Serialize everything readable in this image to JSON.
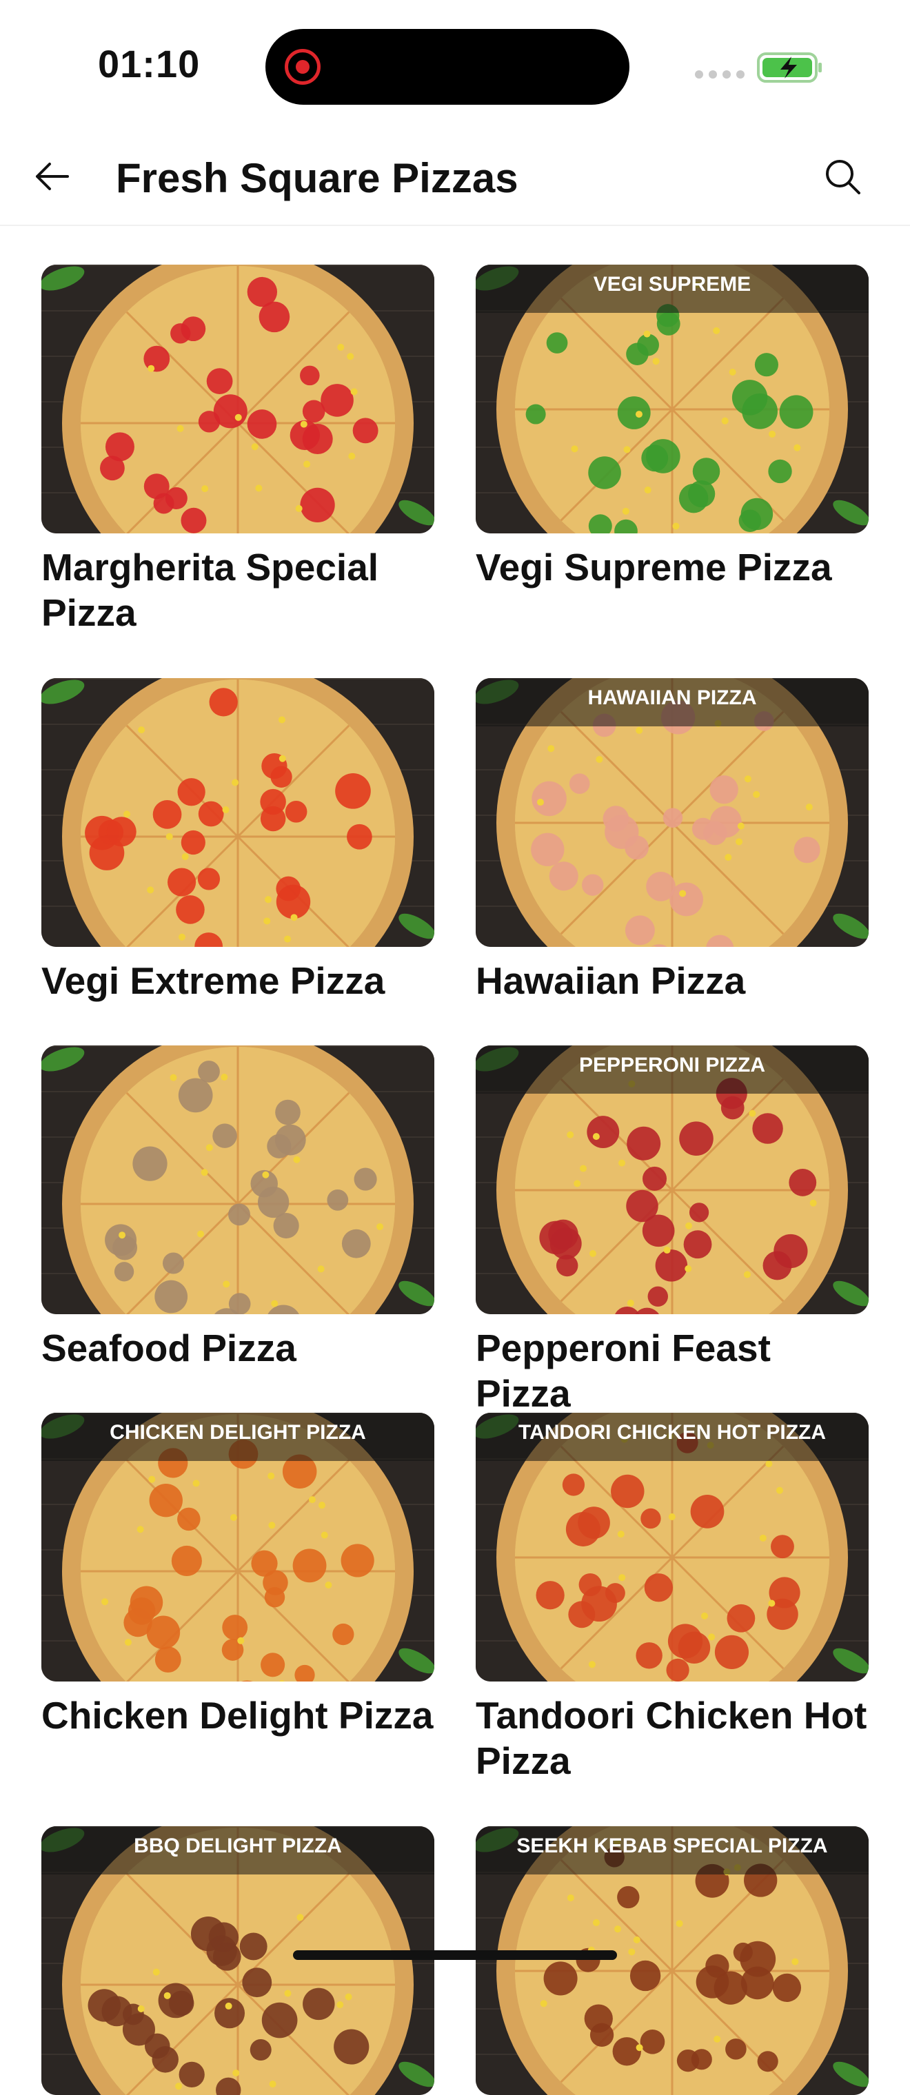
{
  "status_bar": {
    "time": "01:10"
  },
  "header": {
    "title": "Fresh Square Pizzas"
  },
  "items": [
    {
      "name": "Margherita Special Pizza",
      "banner": "",
      "color": "#d7262b"
    },
    {
      "name": "Vegi Supreme Pizza",
      "banner": "VEGI SUPREME",
      "color": "#3c9b2e"
    },
    {
      "name": "Vegi Extreme Pizza",
      "banner": "",
      "color": "#e23b1f"
    },
    {
      "name": "Hawaiian Pizza",
      "banner": "HAWAIIAN PIZZA",
      "color": "#e8a08a"
    },
    {
      "name": "Seafood Pizza",
      "banner": "",
      "color": "#a78a6a"
    },
    {
      "name": "Pepperoni Feast Pizza",
      "banner": "PEPPERONI PIZZA",
      "color": "#b8262a"
    },
    {
      "name": "Chicken Delight Pizza",
      "banner": "CHICKEN DELIGHT PIZZA",
      "color": "#e06a20"
    },
    {
      "name": "Tandoori Chicken Hot Pizza",
      "banner": "TANDORI CHICKEN HOT PIZZA",
      "color": "#d64520"
    },
    {
      "name": "",
      "banner": "BBQ DELIGHT PIZZA",
      "color": "#7a3a20"
    },
    {
      "name": "",
      "banner": "SEEKH KEBAB SPECIAL PIZZA",
      "color": "#8a3a1a"
    }
  ]
}
